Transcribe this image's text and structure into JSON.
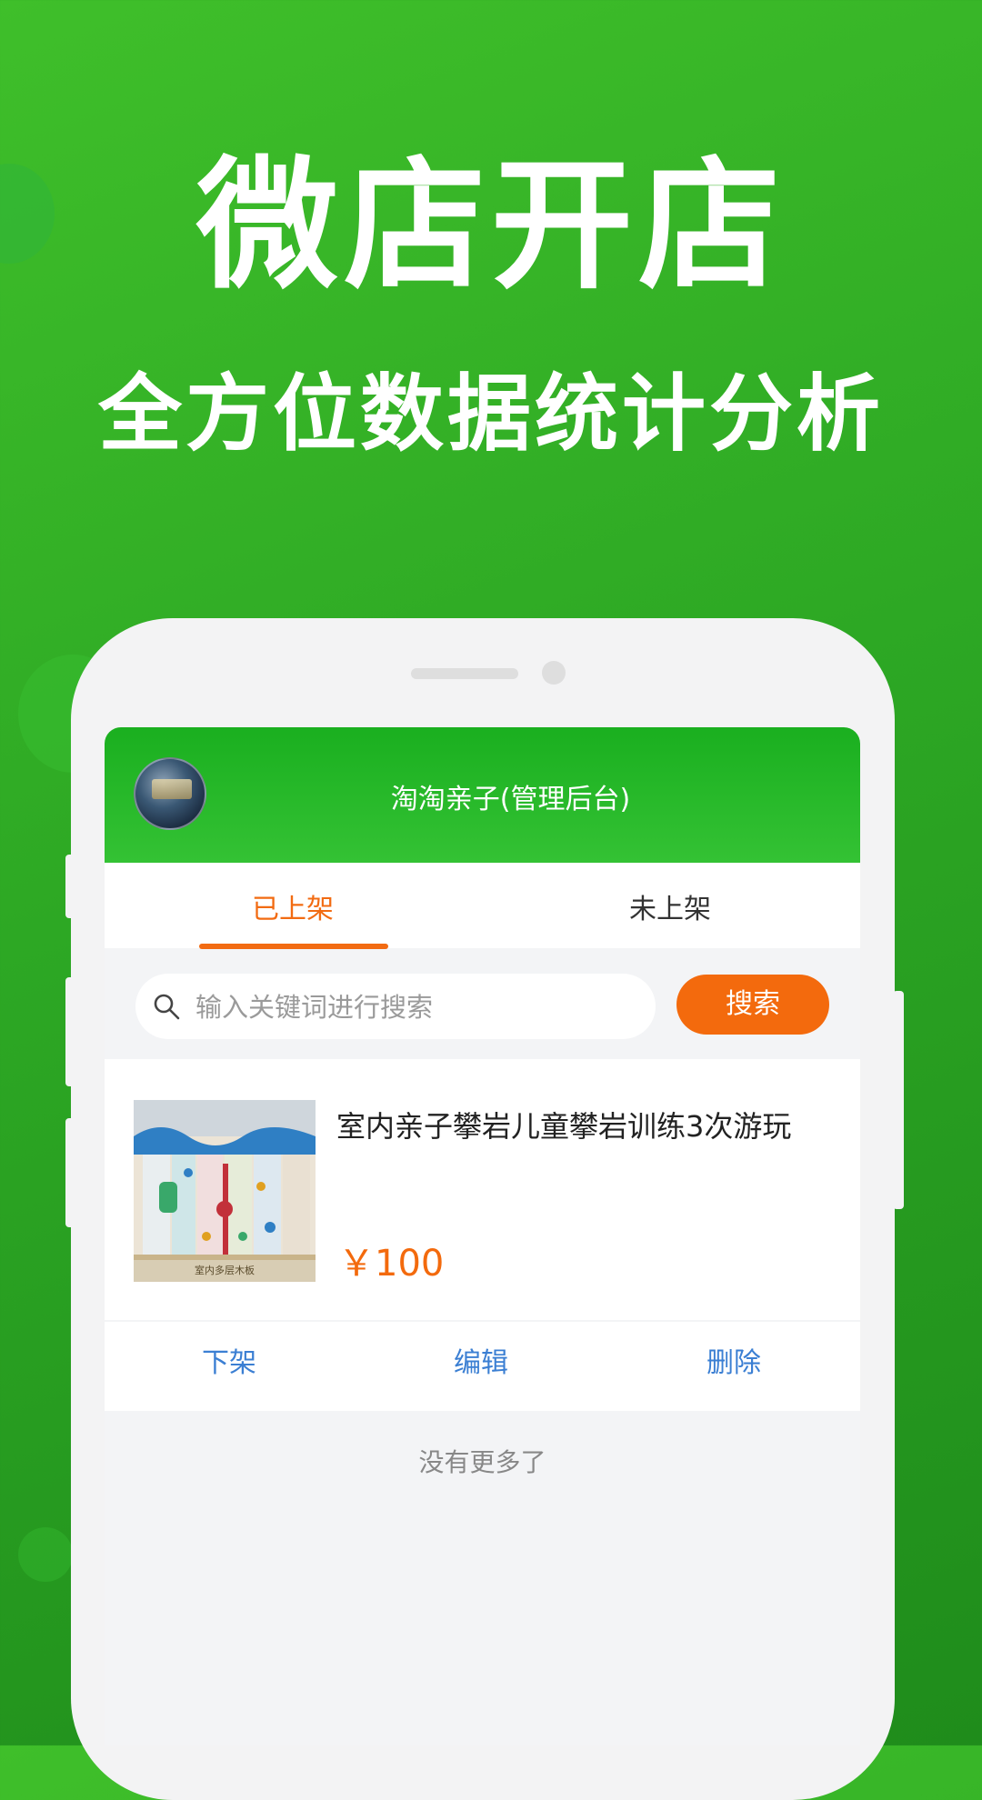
{
  "hero": {
    "headline": "微店开店",
    "subline": "全方位数据统计分析"
  },
  "app": {
    "title": "淘淘亲子(管理后台)",
    "avatar": "store-avatar"
  },
  "tabs": [
    {
      "label": "已上架",
      "active": true
    },
    {
      "label": "未上架",
      "active": false
    }
  ],
  "search": {
    "placeholder": "输入关键词进行搜索",
    "value": "",
    "button_label": "搜索"
  },
  "product": {
    "title": "室内亲子攀岩儿童攀岩训练3次游玩",
    "price": "￥100",
    "image_caption": "室内多层木板",
    "actions": {
      "unlist": "下架",
      "edit": "编辑",
      "delete": "删除"
    }
  },
  "footer_text": "没有更多了",
  "colors": {
    "brand_green": "#2da824",
    "accent_orange": "#f26b12",
    "action_blue": "#3b7fd3"
  }
}
